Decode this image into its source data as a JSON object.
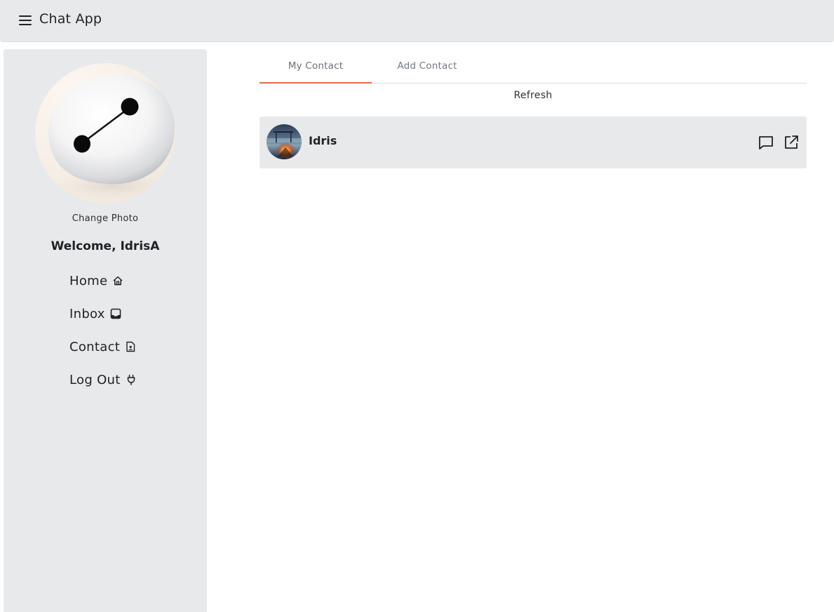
{
  "header": {
    "menu_icon": "hamburger-menu-icon",
    "title": "Chat App"
  },
  "sidebar": {
    "avatar_icon": "profile-photo",
    "change_photo_label": "Change Photo",
    "welcome_text": "Welcome, IdrisA",
    "items": [
      {
        "label": "Home",
        "icon": "home-icon"
      },
      {
        "label": "Inbox",
        "icon": "inbox-icon"
      },
      {
        "label": "Contact",
        "icon": "contact-file-icon"
      },
      {
        "label": "Log Out",
        "icon": "plug-icon"
      }
    ]
  },
  "tabs": [
    {
      "label": "My Contact",
      "active": true
    },
    {
      "label": "Add Contact",
      "active": false
    }
  ],
  "refresh_label": "Refresh",
  "contacts": [
    {
      "name": "Idris",
      "avatar_icon": "contact-avatar",
      "actions": [
        "chat-icon",
        "open-external-icon"
      ]
    }
  ],
  "colors": {
    "accent": "#e8674b",
    "panel": "#e8e9ea",
    "text": "#1d2228"
  }
}
